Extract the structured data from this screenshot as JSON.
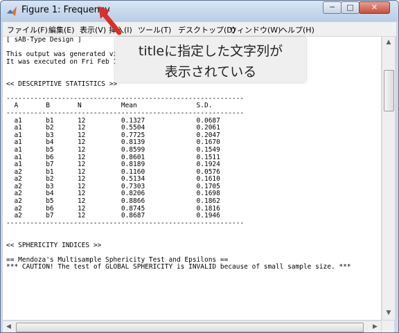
{
  "window": {
    "title": "Figure 1: Frequency",
    "controls": {
      "minimize": "─",
      "maximize": "□",
      "close": "✕"
    }
  },
  "menu": [
    "ファイル(F)",
    "編集(E)",
    "表示(V)",
    "挿入(I)",
    "ツール(T)",
    "デスクトップ(D)",
    "ウィンドウ(W)",
    "ヘルプ(H)"
  ],
  "output_text": "[ sAB-Type Design ]\n\nThis output was generated vi\nIt was executed on Fri Feb 1\n\n\n<< DESCRIPTIVE STATISTICS >>\n\n------------------------------------------------------------\n  A       B       N          Mean               S.D.\n------------------------------------------------------------\n  a1      b1      12         0.1327             0.0687\n  a1      b2      12         0.5504             0.2061\n  a1      b3      12         0.7725             0.2047\n  a1      b4      12         0.8139             0.1670\n  a1      b5      12         0.8599             0.1549\n  a1      b6      12         0.8601             0.1511\n  a1      b7      12         0.8189             0.1924\n  a2      b1      12         0.1160             0.0576\n  a2      b2      12         0.5134             0.1610\n  a2      b3      12         0.7303             0.1705\n  a2      b4      12         0.8206             0.1698\n  a2      b5      12         0.8866             0.1862\n  a2      b6      12         0.8745             0.1816\n  a2      b7      12         0.8687             0.1946\n------------------------------------------------------------\n\n\n<< SPHERICITY INDICES >>\n\n== Mendoza's Multisample Sphericity Test and Epsilons ==\n*** CAUTION! The test of GLOBAL SPHERICITY is INVALID because of small sample size. ***",
  "callout": {
    "line1": "titleに指定した文字列が",
    "line2": "表示されている"
  },
  "scroll": {
    "up": "▲",
    "down": "▼",
    "left": "◀",
    "right": "▶"
  },
  "colors": {
    "arrow": "#d9302a",
    "close_button": "#c74f3b",
    "titlebar": "#c9d8ea"
  }
}
